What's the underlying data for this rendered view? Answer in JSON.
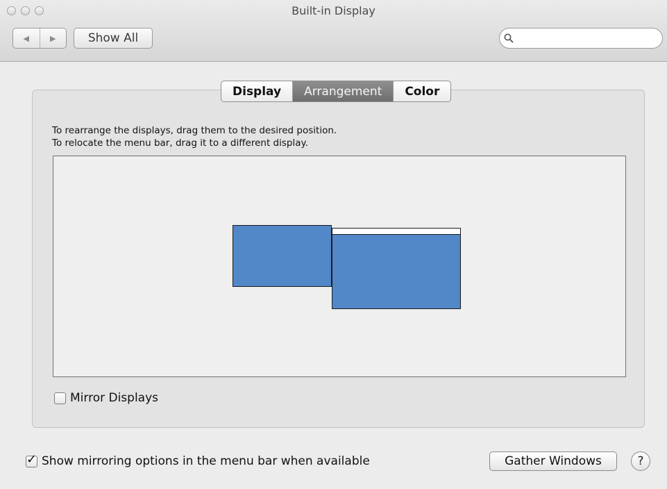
{
  "window": {
    "title": "Built-in Display"
  },
  "toolbar": {
    "back_icon": "back-arrow-icon",
    "forward_icon": "forward-arrow-icon",
    "show_all_label": "Show All",
    "search_value": "",
    "search_placeholder": ""
  },
  "tabs": [
    {
      "label": "Display",
      "selected": false
    },
    {
      "label": "Arrangement",
      "selected": true
    },
    {
      "label": "Color",
      "selected": false
    }
  ],
  "arrangement": {
    "instruction_line1": "To rearrange the displays, drag them to the desired position.",
    "instruction_line2": "To relocate the menu bar, drag it to a different display.",
    "display_color": "#5287c8"
  },
  "mirror_displays": {
    "label": "Mirror Displays",
    "checked": false
  },
  "show_mirroring": {
    "label": "Show mirroring options in the menu bar when available",
    "checked": true
  },
  "gather_windows_label": "Gather Windows",
  "help_label": "?"
}
